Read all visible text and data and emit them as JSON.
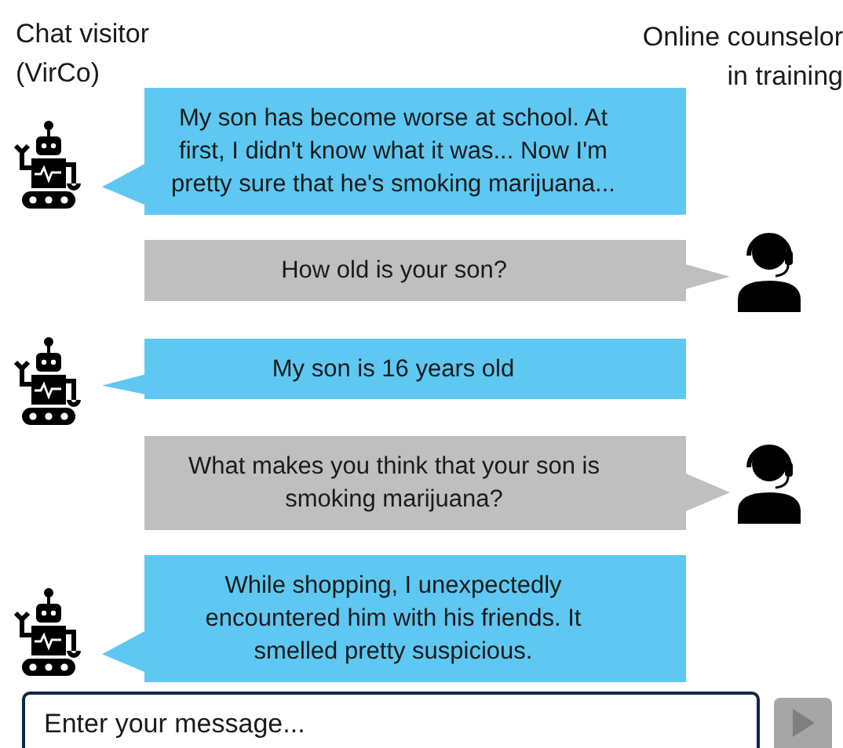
{
  "participants": {
    "visitor": [
      "Chat visitor",
      "(VirCo)"
    ],
    "counselor": [
      "Online counselor",
      "in training"
    ]
  },
  "messages": [
    {
      "kind": "visitor",
      "text": "My son has become worse at school. At first, I didn't know what it was... Now I'm pretty sure that he's smoking marijuana..."
    },
    {
      "kind": "counselor",
      "text": "How old is your son?"
    },
    {
      "kind": "visitor",
      "text": "My son is 16 years old"
    },
    {
      "kind": "counselor",
      "text": "What makes you think that your son is smoking marijuana?"
    },
    {
      "kind": "visitor",
      "text": "While shopping, I unexpectedly encountered him with his friends. It smelled pretty suspicious."
    }
  ],
  "input": {
    "placeholder": "Enter your message..."
  }
}
